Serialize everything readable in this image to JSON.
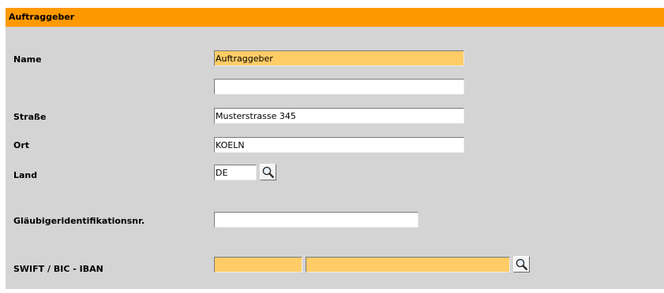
{
  "section": {
    "title": "Auftraggeber"
  },
  "fields": {
    "name": {
      "label": "Name",
      "value": "Auftraggeber"
    },
    "name2": {
      "value": ""
    },
    "strasse": {
      "label": "Straße",
      "value": "Musterstrasse 345"
    },
    "ort": {
      "label": "Ort",
      "value": "KOELN"
    },
    "land": {
      "label": "Land",
      "value": "DE",
      "lookup_icon": "magnifier-icon"
    },
    "glaeubiger_id": {
      "label": "Gläubigeridentifikationsnr.",
      "value": ""
    },
    "swift_iban": {
      "label": "SWIFT / BIC - IBAN",
      "swift_value": "",
      "iban_value": "",
      "lookup_icon": "magnifier-icon"
    }
  },
  "colors": {
    "header_orange": "#ff9900",
    "panel_gray": "#d4d4d4",
    "required_field": "#ffcc66"
  }
}
